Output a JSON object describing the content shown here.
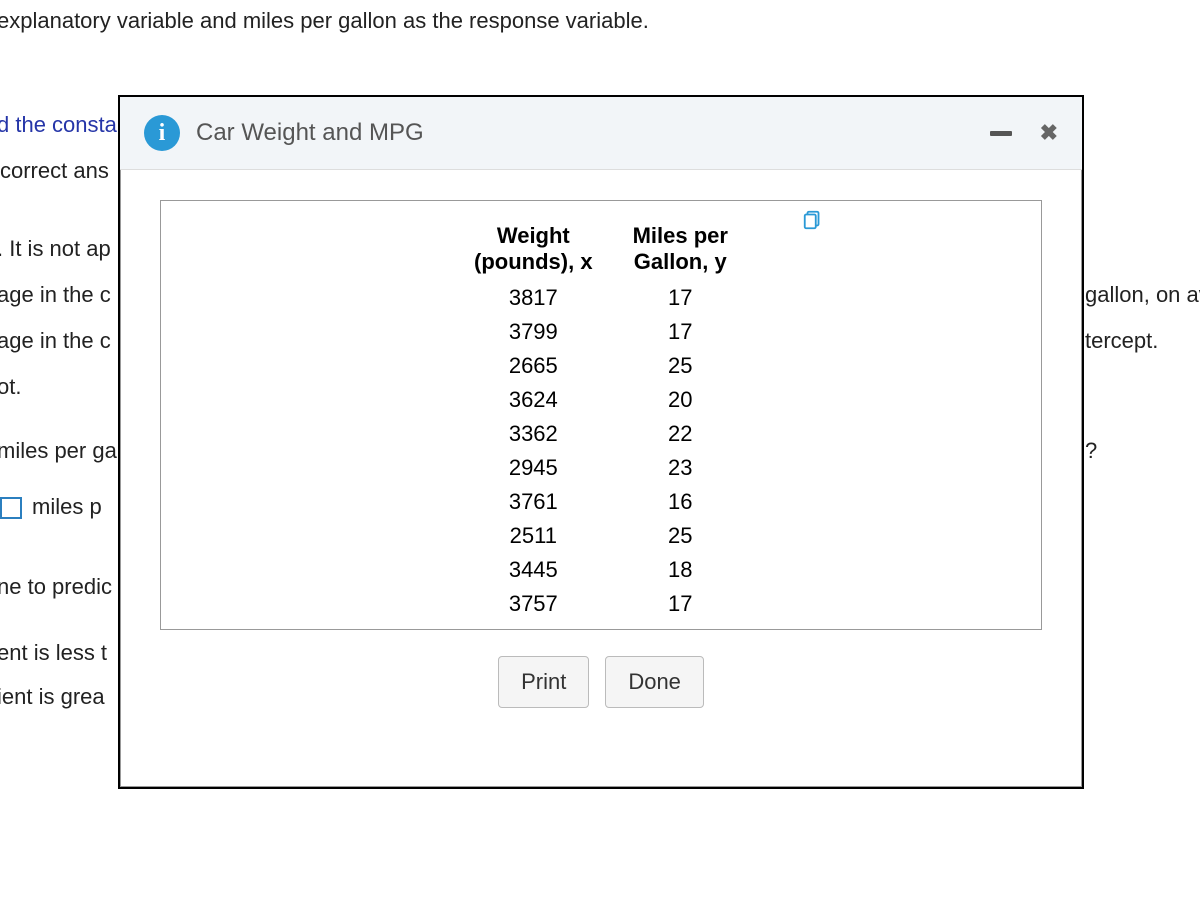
{
  "background": {
    "line_top": "explanatory variable and miles per gallon as the response variable.",
    "frag_consta": "d the consta",
    "frag_correct_ans": "correct ans",
    "frag_not_ap": ". It is not ap",
    "frag_age1": "age in the c",
    "frag_age2": "age in the c",
    "frag_ot": "ot.",
    "frag_miles_ga": "miles per ga",
    "frag_miles_p": "miles p",
    "frag_predict": "ne to predic",
    "frag_ent_less": "ent is less t",
    "frag_ient_grea": "ient is grea",
    "frag_gallon_av": "gallon, on av",
    "frag_tercept": "tercept.",
    "frag_qmark": "?"
  },
  "modal": {
    "title": "Car Weight and MPG",
    "info_glyph": "i",
    "close_glyph": "✖",
    "buttons": {
      "print": "Print",
      "done": "Done"
    }
  },
  "table": {
    "header_x_line1": "Weight",
    "header_x_line2": "(pounds), x",
    "header_y_line1": "Miles per",
    "header_y_line2": "Gallon, y",
    "rows": [
      {
        "x": "3817",
        "y": "17"
      },
      {
        "x": "3799",
        "y": "17"
      },
      {
        "x": "2665",
        "y": "25"
      },
      {
        "x": "3624",
        "y": "20"
      },
      {
        "x": "3362",
        "y": "22"
      },
      {
        "x": "2945",
        "y": "23"
      },
      {
        "x": "3761",
        "y": "16"
      },
      {
        "x": "2511",
        "y": "25"
      },
      {
        "x": "3445",
        "y": "18"
      },
      {
        "x": "3757",
        "y": "17"
      }
    ]
  },
  "chart_data": {
    "type": "table",
    "title": "Car Weight and MPG",
    "xlabel": "Weight (pounds), x",
    "ylabel": "Miles per Gallon, y",
    "x": [
      3817,
      3799,
      2665,
      3624,
      3362,
      2945,
      3761,
      2511,
      3445,
      3757
    ],
    "y": [
      17,
      17,
      25,
      20,
      22,
      23,
      16,
      25,
      18,
      17
    ]
  }
}
